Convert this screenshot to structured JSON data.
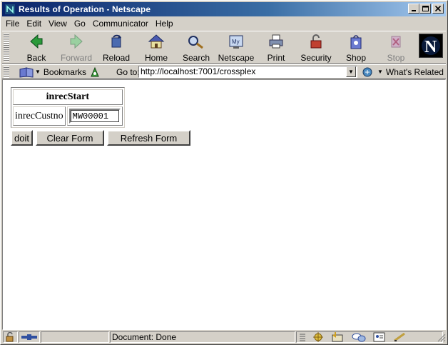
{
  "window": {
    "title": "Results of Operation - Netscape",
    "minimize": "_",
    "maximize": "□",
    "close": "✕"
  },
  "menu": [
    {
      "label": "File"
    },
    {
      "label": "Edit"
    },
    {
      "label": "View"
    },
    {
      "label": "Go"
    },
    {
      "label": "Communicator"
    },
    {
      "label": "Help"
    }
  ],
  "toolbar": {
    "back": "Back",
    "forward": "Forward",
    "reload": "Reload",
    "home": "Home",
    "search": "Search",
    "netscape": "Netscape",
    "print": "Print",
    "security": "Security",
    "shop": "Shop",
    "stop": "Stop",
    "logo": "N"
  },
  "location": {
    "bookmarks": "Bookmarks",
    "goto": "Go to:",
    "url": "http://localhost:7001/crossplex",
    "related": "What's Related"
  },
  "form": {
    "header": "inrecStart",
    "field_label": "inrecCustno",
    "field_value": "MW00001",
    "doit": "doit",
    "clear": "Clear Form",
    "refresh": "Refresh Form"
  },
  "status": {
    "text": "Document: Done"
  },
  "colors": {
    "titlebar_start": "#0a246a",
    "titlebar_end": "#a6caf0",
    "chrome": "#d4d0c8"
  }
}
